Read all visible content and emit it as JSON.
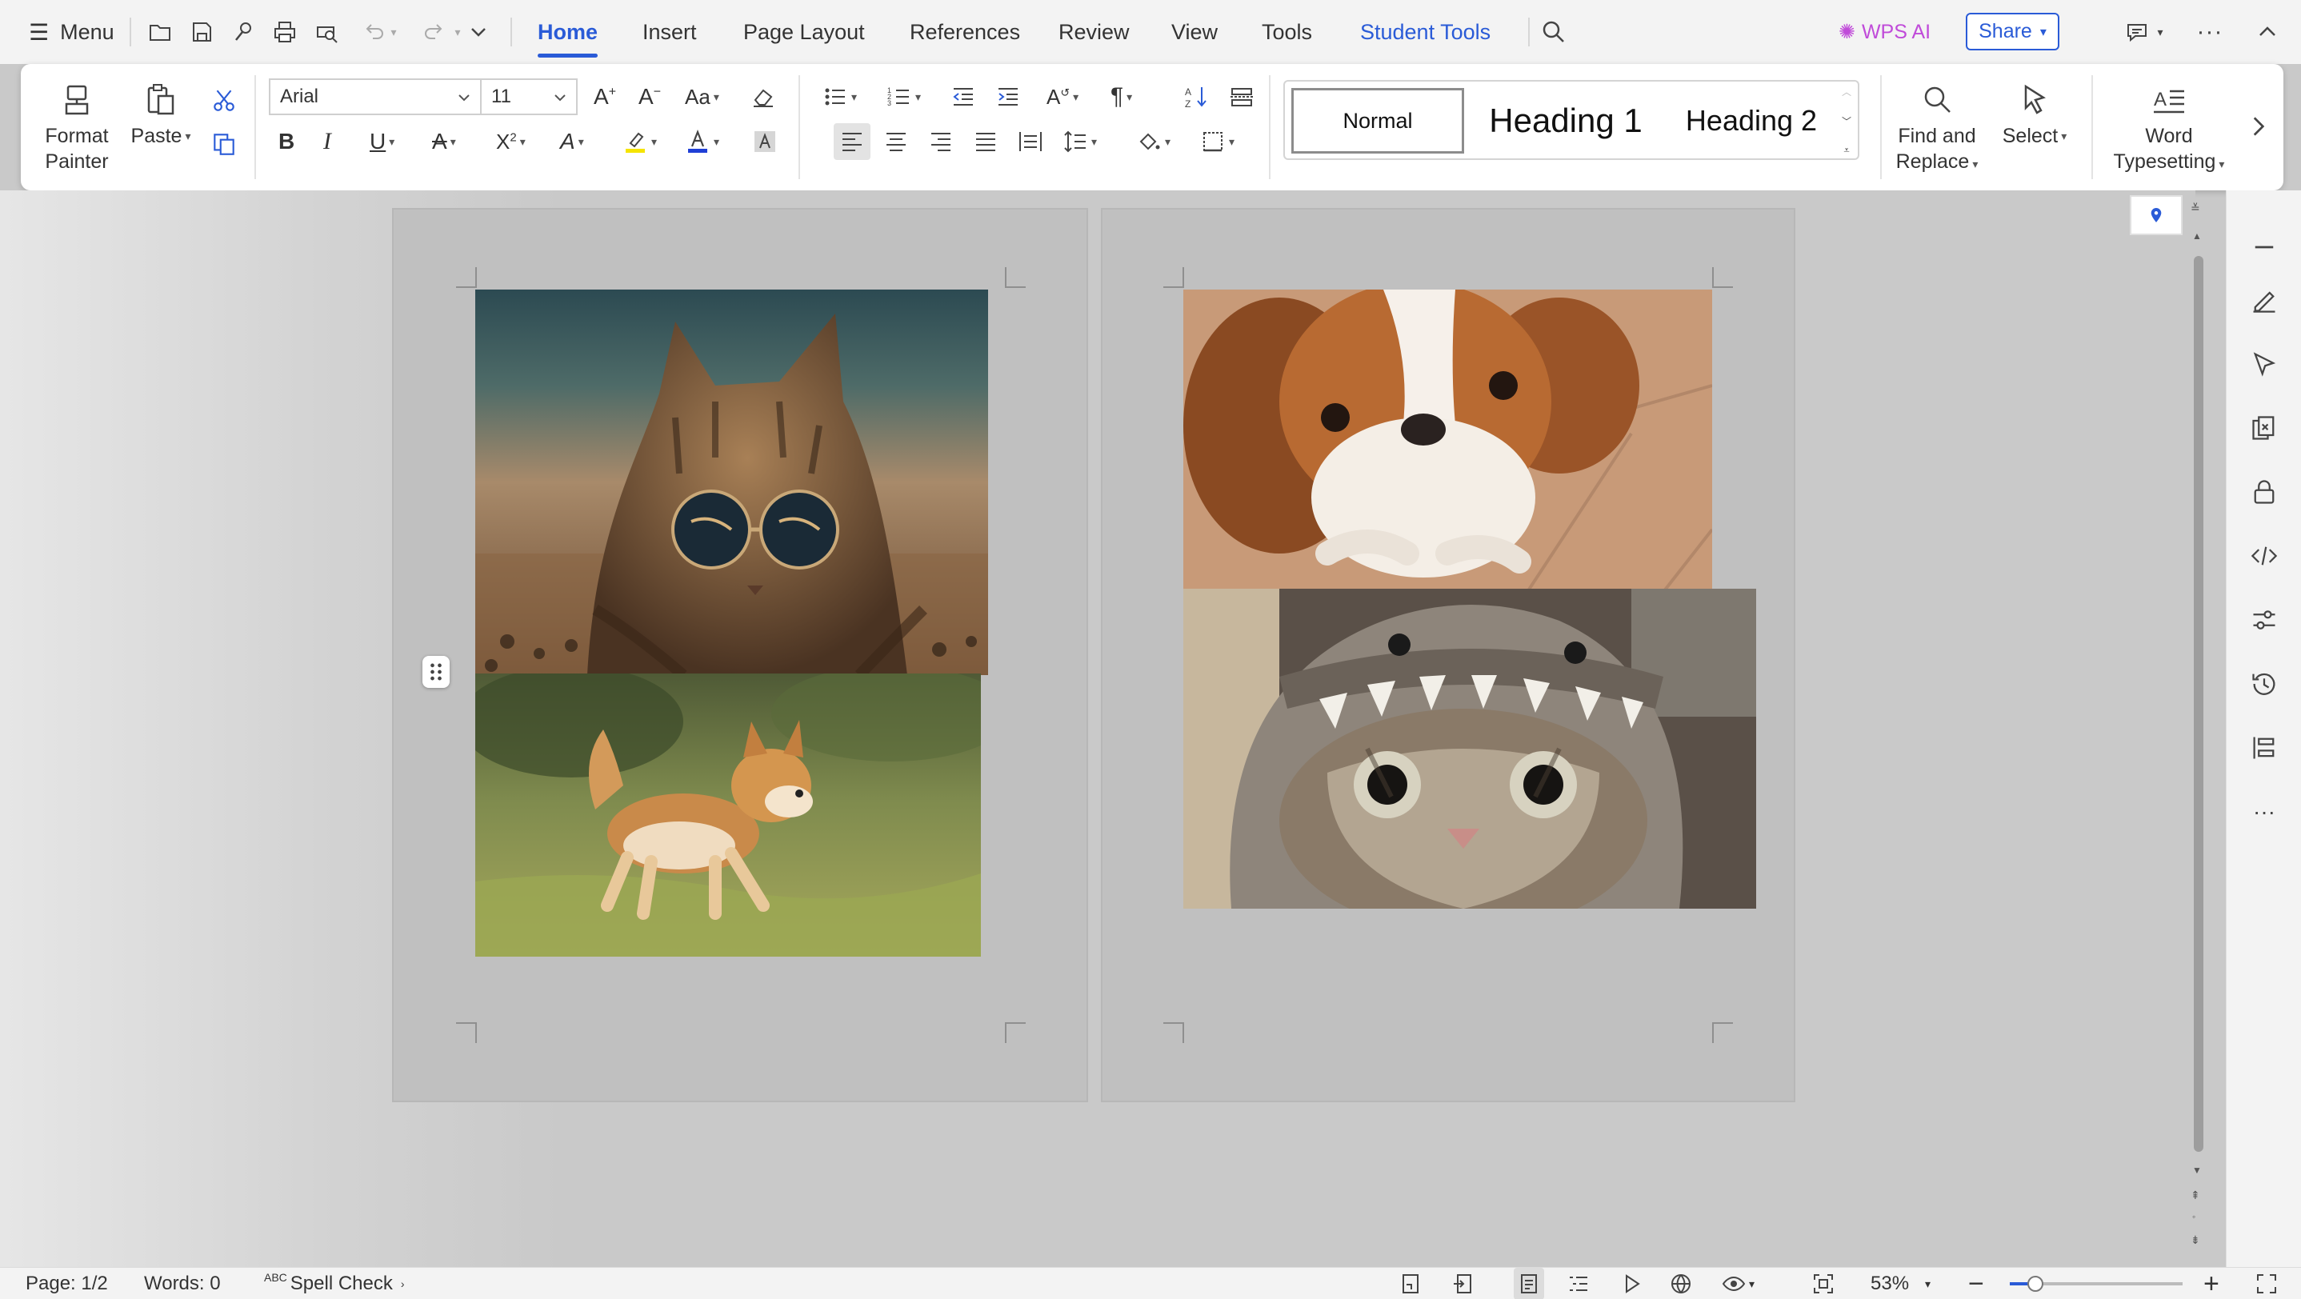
{
  "menubar": {
    "menu_label": "Menu",
    "tabs": [
      {
        "label": "Home",
        "active": true
      },
      {
        "label": "Insert"
      },
      {
        "label": "Page Layout"
      },
      {
        "label": "References"
      },
      {
        "label": "Review"
      },
      {
        "label": "View"
      },
      {
        "label": "Tools"
      },
      {
        "label": "Student Tools"
      }
    ],
    "wps_ai_label": "WPS AI",
    "share_label": "Share"
  },
  "ribbon": {
    "format_painter_label": "Format Painter",
    "paste_label": "Paste",
    "font_name": "Arial",
    "font_size": "11",
    "styles": {
      "normal": "Normal",
      "heading1": "Heading 1",
      "heading2": "Heading 2"
    },
    "find_replace_label": "Find and Replace",
    "select_label": "Select",
    "word_typesetting_label": "Word Typesetting"
  },
  "document": {
    "pages": 2,
    "images": [
      {
        "page": 1,
        "subject": "Cat wearing sunglasses on the beach"
      },
      {
        "page": 1,
        "subject": "Corgi running on grass"
      },
      {
        "page": 2,
        "subject": "Cavalier King Charles spaniel on tiles"
      },
      {
        "page": 2,
        "subject": "Cat wearing a knitted shark hat"
      }
    ]
  },
  "statusbar": {
    "page": "Page: 1/2",
    "words": "Words: 0",
    "spell_check": "Spell Check",
    "spell_prefix": "ABC",
    "zoom": "53%",
    "zoom_fraction": 0.15
  },
  "colors": {
    "accent": "#2a5bd7",
    "wps_ai": "#c04bd9",
    "highlight_yellow": "#f5e400",
    "font_color_blue": "#1f3fd6"
  }
}
